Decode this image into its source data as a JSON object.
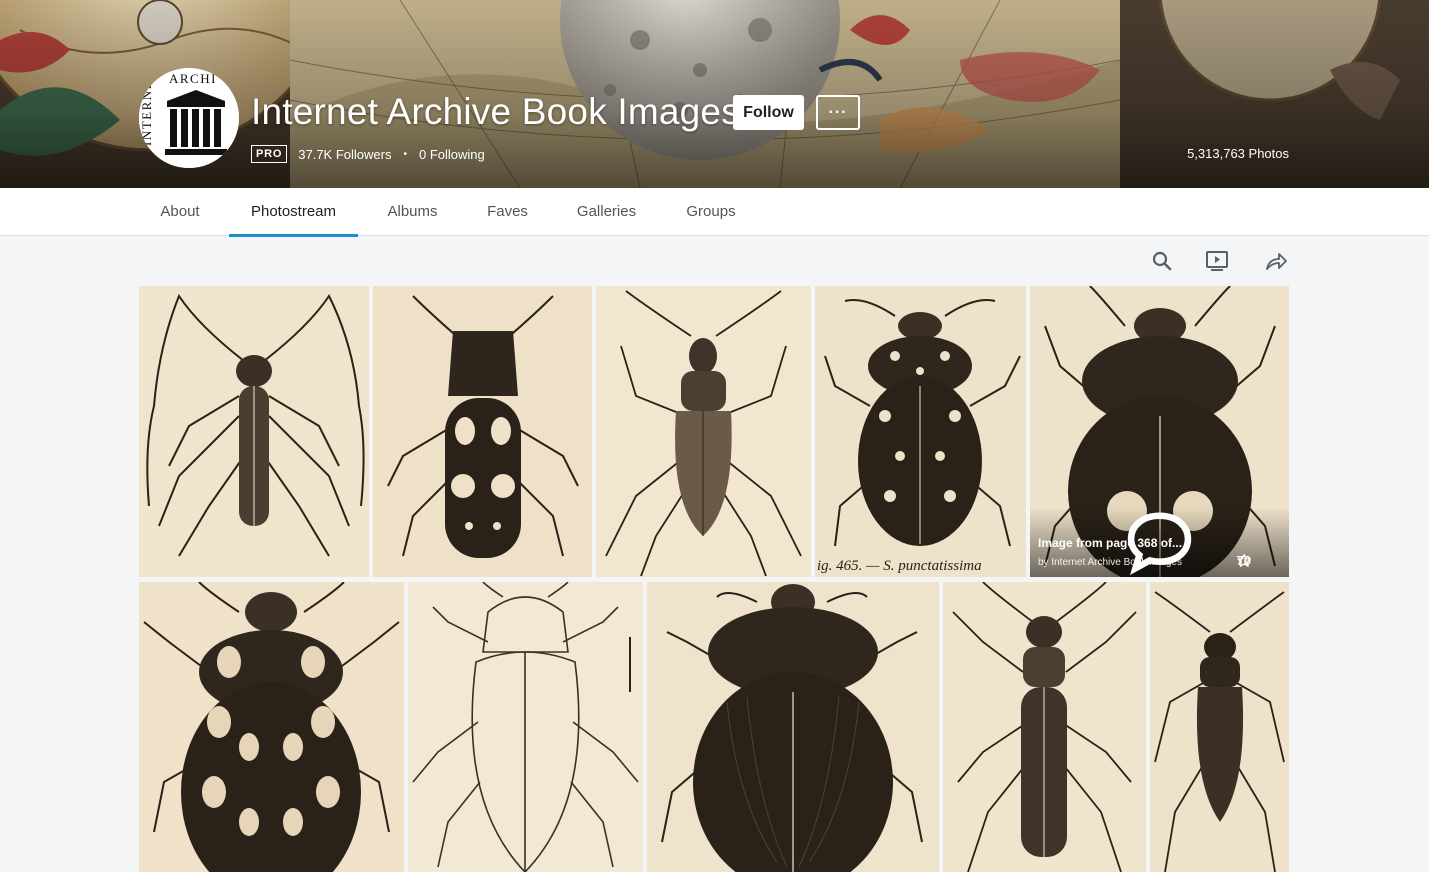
{
  "profile": {
    "name": "Internet Archive Book Images",
    "avatar_text": "INTERNET ARCHIVE",
    "pro_badge": "PRO",
    "followers": "37.7K Followers",
    "following": "0 Following",
    "photo_count": "5,313,763 Photos",
    "follow_label": "Follow",
    "more_label": "···"
  },
  "nav": {
    "tabs": [
      {
        "label": "About",
        "active": false
      },
      {
        "label": "Photostream",
        "active": true
      },
      {
        "label": "Albums",
        "active": false
      },
      {
        "label": "Faves",
        "active": false
      },
      {
        "label": "Galleries",
        "active": false
      },
      {
        "label": "Groups",
        "active": false
      }
    ]
  },
  "toolbar": {
    "icons": [
      "search-icon",
      "slideshow-icon",
      "share-icon"
    ]
  },
  "hovered_photo": {
    "title": "Image from page 368 of...",
    "owner": "by Internet Archive Book Images",
    "faves": "70"
  },
  "photos": {
    "caption_beetle_4": "ig. 465. — S. punctatissima"
  },
  "colors": {
    "accent": "#1c8fd3",
    "page_bg": "#f3f5f6",
    "paper": "#f0e3cc",
    "ink": "#2a2218"
  }
}
